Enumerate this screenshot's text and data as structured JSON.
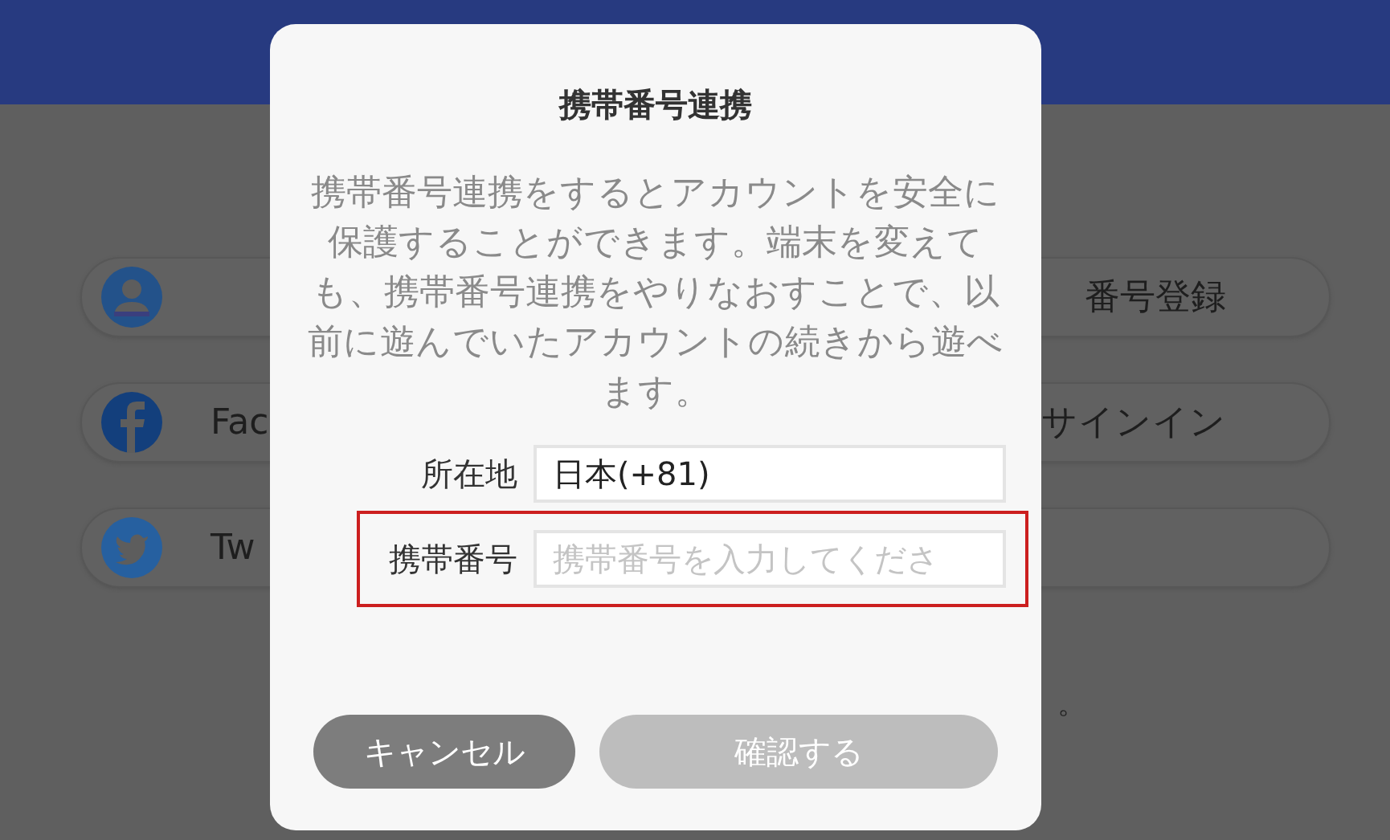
{
  "background": {
    "rows": [
      {
        "kind": "account",
        "right_text": "番号登録"
      },
      {
        "kind": "facebook",
        "left_text": "Fac",
        "right_text": "サインイン"
      },
      {
        "kind": "twitter",
        "left_text": "Tw"
      }
    ],
    "note": "。"
  },
  "dialog": {
    "title": "携帯番号連携",
    "message": "携帯番号連携をするとアカウントを安全に保護することができます。端末を変えても、携帯番号連携をやりなおすことで、以前に遊んでいたアカウントの続きから遊べます。",
    "fields": [
      {
        "label": "所在地",
        "value": "日本(+81)",
        "highlighted": false
      },
      {
        "label": "携帯番号",
        "placeholder": "携帯番号を入力してくださ",
        "highlighted": true
      }
    ],
    "buttons": [
      {
        "label": "キャンセル",
        "kind": "cancel",
        "disabled": false
      },
      {
        "label": "確認する",
        "kind": "confirm",
        "disabled": true
      }
    ]
  }
}
